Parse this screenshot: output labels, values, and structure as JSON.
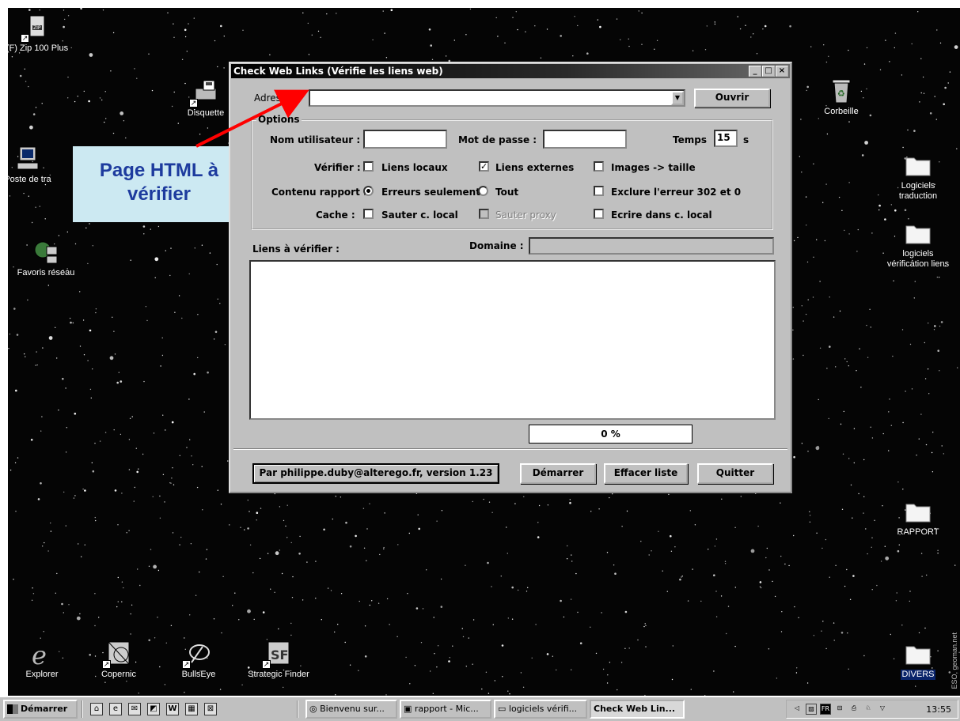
{
  "desktop": {
    "watermark": "ESO, geoman.net",
    "icons_left": [
      {
        "label": "(F) Zip 100 Plus",
        "icon": "zip-drive-icon"
      },
      {
        "label": "Disquette",
        "icon": "floppy-drive-icon"
      },
      {
        "label": "Poste de tra",
        "icon": "my-computer-icon"
      },
      {
        "label": "Favoris réseau",
        "icon": "network-places-icon"
      }
    ],
    "icons_right": [
      {
        "label": "Corbeille",
        "icon": "recycle-bin-icon"
      },
      {
        "label": "Logiciels traduction",
        "icon": "folder-icon"
      },
      {
        "label": "logiciels vérification liens",
        "icon": "folder-icon"
      },
      {
        "label": "RAPPORT",
        "icon": "folder-icon"
      },
      {
        "label": "DIVERS",
        "icon": "folder-icon"
      }
    ],
    "icons_bottom": [
      {
        "label": "Explorer",
        "icon": "internet-explorer-icon"
      },
      {
        "label": "Copernic",
        "icon": "copernic-icon"
      },
      {
        "label": "BullsEye",
        "icon": "bullseye-icon"
      },
      {
        "label": "Strategic Finder",
        "icon": "strategic-finder-icon"
      }
    ]
  },
  "dialog": {
    "title": "Check Web Links (Vérifie les liens web)",
    "title_buttons": [
      "_",
      "□",
      "×"
    ],
    "adresse_label": "Adresse :",
    "adresse_value": "",
    "ouvrir_label": "Ouvrir",
    "options_title": "Options",
    "user_label": "Nom utilisateur :",
    "user_value": "",
    "password_label": "Mot de passe :",
    "password_value": "",
    "temps_label": "Temps",
    "temps_value": "15",
    "temps_unit": "s",
    "verifier_label": "Vérifier :",
    "liens_locaux": {
      "label": "Liens locaux",
      "checked": false
    },
    "liens_externes": {
      "label": "Liens externes",
      "checked": true
    },
    "images_taille": {
      "label": "Images -> taille",
      "checked": false
    },
    "contenu_label": "Contenu rapport :",
    "erreurs_seulement": {
      "label": "Erreurs seulement",
      "selected": true
    },
    "tout": {
      "label": "Tout",
      "selected": false
    },
    "exclure_302": {
      "label": "Exclure l'erreur 302 et 0",
      "checked": false
    },
    "cache_label": "Cache :",
    "sauter_local": {
      "label": "Sauter c. local",
      "checked": false
    },
    "sauter_proxy": {
      "label": "Sauter proxy",
      "checked": false,
      "disabled": true
    },
    "ecrire_local": {
      "label": "Ecrire dans c. local",
      "checked": false
    },
    "liens_label": "Liens à vérifier :",
    "domaine_label": "Domaine :",
    "domaine_value": "",
    "progress_text": "0 %",
    "progress_fraction": 0,
    "author_button": "Par philippe.duby@alterego.fr, version 1.23",
    "demarrer_button": "Démarrer",
    "effacer_button": "Effacer liste",
    "quitter_button": "Quitter"
  },
  "annotation": {
    "text_line1": "Page HTML à",
    "text_line2": "vérifier",
    "arrow_color": "#ff0000"
  },
  "taskbar": {
    "start_label": "Démarrer",
    "quicklaunch": [
      "desktop-icon",
      "ie-icon",
      "outlook-icon",
      "channel-icon",
      "word-icon",
      "calc-icon",
      "copernic-icon"
    ],
    "tasks": [
      {
        "label": "Bienvenu sur...",
        "active": false
      },
      {
        "label": "rapport - Mic...",
        "active": false
      },
      {
        "label": "logiciels vérifi...",
        "active": false
      },
      {
        "label": "Check Web Lin...",
        "active": true
      }
    ],
    "tray_lang": "FR",
    "clock": "13:55"
  }
}
